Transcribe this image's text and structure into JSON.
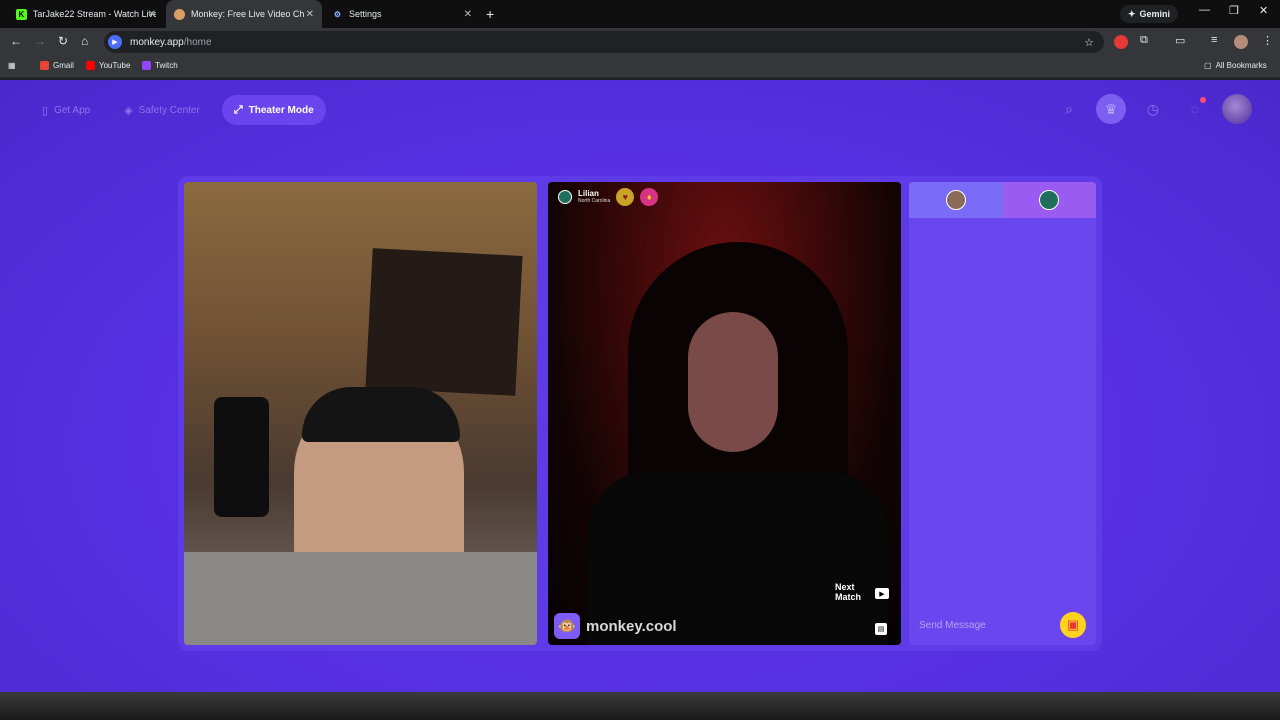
{
  "browser": {
    "tabs": [
      {
        "title": "TarJake22 Stream - Watch Live",
        "favicon": "K",
        "active": false
      },
      {
        "title": "Monkey: Free Live Video Ch",
        "favicon": "monkey",
        "active": true
      },
      {
        "title": "Settings",
        "favicon": "gear",
        "active": false
      }
    ],
    "gemini_label": "Gemini",
    "url_host": "monkey.app",
    "url_path": "/home",
    "bookmarks": [
      {
        "label": "Gmail",
        "color": "#ea4335"
      },
      {
        "label": "YouTube",
        "color": "#ff0000"
      },
      {
        "label": "Twitch",
        "color": "#9146ff"
      }
    ],
    "all_bookmarks": "All Bookmarks"
  },
  "app": {
    "nav": {
      "get_app": "Get App",
      "safety_center": "Safety Center",
      "theater_mode": "Theater Mode"
    },
    "peer": {
      "name": "Lilian",
      "location": "North Carolina"
    },
    "next_match": "Next\nMatch",
    "brand": "monkey.cool",
    "chat_placeholder": "Send Message"
  },
  "colors": {
    "page_bg": "#5530e0",
    "accent": "#7c5cf4",
    "gift": "#ffd21f"
  }
}
